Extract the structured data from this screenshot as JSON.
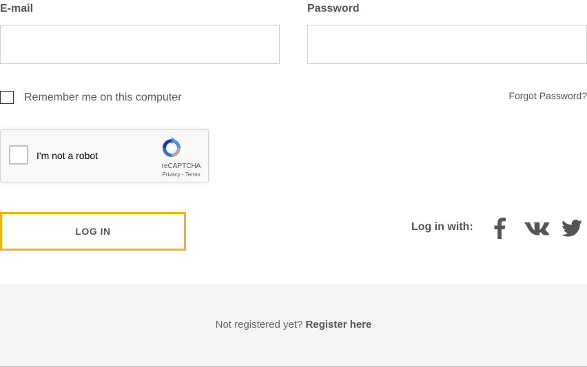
{
  "form": {
    "email_label": "E-mail",
    "email_value": "",
    "password_label": "Password",
    "password_value": "",
    "remember_label": "Remember me on this computer",
    "forgot_label": "Forgot Password?",
    "login_label": "LOG IN"
  },
  "captcha": {
    "label": "I'm not a robot",
    "brand": "reCAPTCHA",
    "links": "Privacy - Terms"
  },
  "social": {
    "label": "Log in with:",
    "icons": [
      "facebook-icon",
      "vk-icon",
      "twitter-icon"
    ],
    "icon_color": "#555555"
  },
  "footer": {
    "prompt": "Not registered yet?",
    "register_label": "Register here"
  },
  "colors": {
    "accent": "#f5b50a",
    "footer_bg": "#f5f5f5"
  }
}
